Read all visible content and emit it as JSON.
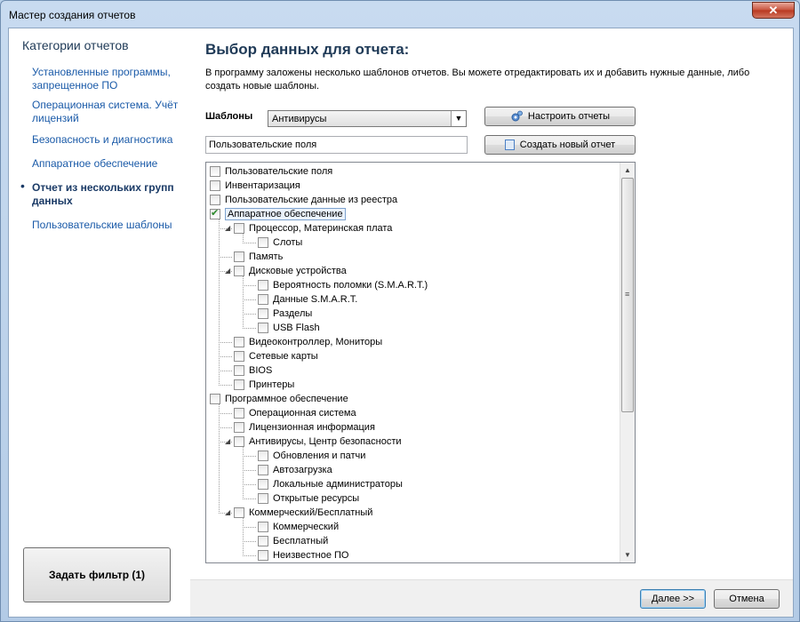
{
  "window": {
    "title": "Мастер создания отчетов",
    "close_glyph": "✕"
  },
  "sidebar": {
    "title": "Категории отчетов",
    "items": [
      {
        "label": "Установленные программы, запрещенное ПО"
      },
      {
        "label": "Операционная система. Учёт лицензий"
      },
      {
        "label": "Безопасность и диагностика"
      },
      {
        "label": "Аппаратное обеспечение"
      },
      {
        "label": "Отчет из нескольких групп данных",
        "active": true
      },
      {
        "label": "Пользовательские шаблоны"
      }
    ],
    "filter_button": "Задать фильтр (1)"
  },
  "main": {
    "title": "Выбор данных для отчета:",
    "description": "В программу заложены несколько шаблонов отчетов. Вы можете отредактировать их и добавить нужные данные, либо создать новые шаблоны.",
    "templates_label": "Шаблоны",
    "templates_value": "Антивирусы",
    "configure_button": "Настроить отчеты",
    "new_report_button": "Создать новый отчет",
    "name_input_value": "Пользовательские поля",
    "tree": [
      {
        "label": "Пользовательские поля",
        "level": 0,
        "checked": false
      },
      {
        "label": "Инвентаризация",
        "level": 0,
        "checked": false
      },
      {
        "label": "Пользовательские данные из реестра",
        "level": 0,
        "checked": false
      },
      {
        "label": "Аппаратное обеспечение",
        "level": 0,
        "checked": true,
        "selected": true
      },
      {
        "label": "Процессор, Материнская плата",
        "level": 1,
        "checked": false,
        "expanded": true
      },
      {
        "label": "Слоты",
        "level": 2,
        "checked": false
      },
      {
        "label": "Память",
        "level": 1,
        "checked": false
      },
      {
        "label": "Дисковые устройства",
        "level": 1,
        "checked": false,
        "expanded": true
      },
      {
        "label": "Вероятность поломки (S.M.A.R.T.)",
        "level": 2,
        "checked": false
      },
      {
        "label": "Данные S.M.A.R.T.",
        "level": 2,
        "checked": false
      },
      {
        "label": "Разделы",
        "level": 2,
        "checked": false
      },
      {
        "label": "USB Flash",
        "level": 2,
        "checked": false
      },
      {
        "label": "Видеоконтроллер, Мониторы",
        "level": 1,
        "checked": false
      },
      {
        "label": "Сетевые карты",
        "level": 1,
        "checked": false
      },
      {
        "label": "BIOS",
        "level": 1,
        "checked": false
      },
      {
        "label": "Принтеры",
        "level": 1,
        "checked": false
      },
      {
        "label": "Программное обеспечение",
        "level": 0,
        "checked": false
      },
      {
        "label": "Операционная система",
        "level": 1,
        "checked": false
      },
      {
        "label": "Лицензионная информация",
        "level": 1,
        "checked": false
      },
      {
        "label": "Антивирусы, Центр безопасности",
        "level": 1,
        "checked": false,
        "expanded": true
      },
      {
        "label": "Обновления и патчи",
        "level": 2,
        "checked": false
      },
      {
        "label": "Автозагрузка",
        "level": 2,
        "checked": false
      },
      {
        "label": "Локальные администраторы",
        "level": 2,
        "checked": false
      },
      {
        "label": "Открытые ресурсы",
        "level": 2,
        "checked": false
      },
      {
        "label": "Коммерческий/Бесплатный",
        "level": 1,
        "checked": false,
        "expanded": true
      },
      {
        "label": "Коммерческий",
        "level": 2,
        "checked": false
      },
      {
        "label": "Бесплатный",
        "level": 2,
        "checked": false
      },
      {
        "label": "Неизвестное ПО",
        "level": 2,
        "checked": false
      }
    ]
  },
  "footer": {
    "next_button": "Далее >>",
    "cancel_button": "Отмена"
  }
}
